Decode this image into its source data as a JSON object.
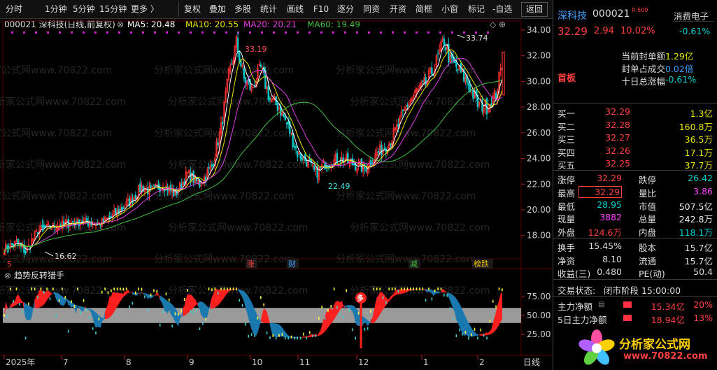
{
  "toolbar": {
    "periods": [
      "分时",
      "1分钟",
      "5分钟",
      "15分钟",
      "更多 〉"
    ],
    "buttons": [
      "复权",
      "叠加",
      "多股",
      "统计",
      "画线",
      "F10",
      "逐分",
      "同资",
      "开资",
      "简框",
      "小窗",
      "标记",
      "-自选"
    ],
    "back": "返回"
  },
  "chart": {
    "title": "000021 深科技(日线,前复权)",
    "ma5": "MA5: 20.48",
    "ma10": "MA10: 20.55",
    "ma20": "MA20: 20.21",
    "ma60": "MA60: 19.49",
    "yticks": [
      "34.00",
      "32.00",
      "30.00",
      "28.00",
      "26.00",
      "24.00",
      "22.00",
      "20.00",
      "18.00"
    ],
    "high1": "33.19",
    "high2": "33.74",
    "low1": "22.49",
    "low0": "16.62",
    "events": [
      "涨",
      "财",
      "减",
      "榜跌"
    ],
    "event_colors": [
      "#ff4040",
      "#40a0ff",
      "#40c040",
      "#e8c000"
    ],
    "s_marker": "S",
    "watermark": "分析家公式网www.70822.com",
    "ind_title": "趋势反转猎手",
    "ind_yticks": [
      "75.00",
      "50.00",
      "25.00"
    ],
    "duo": "多",
    "xticks": [
      "2025年",
      "7",
      "8",
      "9",
      "10",
      "11",
      "12",
      "1",
      "2"
    ],
    "xlabel": "日线"
  },
  "colors": {
    "up": "#ff3030",
    "down": "#00c8c8",
    "ma5": "#ffffff",
    "ma10": "#e8e800",
    "ma20": "#e040e0",
    "ma60": "#40c040"
  },
  "quote": {
    "name": "深科技",
    "code": "000021",
    "tag": "R 500",
    "sector": "消费电子",
    "sector_chg": "-0.61%",
    "price": "32.29",
    "chg": "2.94",
    "pct": "10.02%",
    "board": "首板",
    "seal_amt_label": "当前封单额",
    "seal_amt": "1.29亿",
    "seal_ratio_label": "封单占成交",
    "seal_ratio": "0.02倍",
    "ten_day_label": "十日总涨幅",
    "ten_day": "-0.61%",
    "bids": [
      {
        "label": "买一",
        "price": "32.29",
        "vol": "1.3亿"
      },
      {
        "label": "买二",
        "price": "32.28",
        "vol": "160.8万"
      },
      {
        "label": "买三",
        "price": "32.27",
        "vol": "36.5万"
      },
      {
        "label": "买四",
        "price": "32.26",
        "vol": "17.1万"
      },
      {
        "label": "买五",
        "price": "32.25",
        "vol": "37.7万"
      }
    ],
    "stats": [
      [
        {
          "l": "涨停",
          "v": "32.29",
          "c": "red"
        },
        {
          "l": "跌停",
          "v": "26.42",
          "c": "grn"
        }
      ],
      [
        {
          "l": "最高",
          "v": "32.29",
          "c": "red"
        },
        {
          "l": "量比",
          "v": "3.86",
          "c": "mag"
        }
      ],
      [
        {
          "l": "最低",
          "v": "28.95",
          "c": "grn"
        },
        {
          "l": "市值",
          "v": "507.5亿",
          "c": "wht"
        }
      ],
      [
        {
          "l": "现量",
          "v": "3882",
          "c": "mag"
        },
        {
          "l": "总量",
          "v": "242.8万",
          "c": "wht"
        }
      ],
      [
        {
          "l": "外盘",
          "v": "124.6万",
          "c": "red"
        },
        {
          "l": "内盘",
          "v": "118.1万",
          "c": "grn"
        }
      ]
    ],
    "stats2": [
      [
        {
          "l": "换手",
          "v": "15.45%"
        },
        {
          "l": "股本",
          "v": "15.7亿"
        }
      ],
      [
        {
          "l": "净资",
          "v": "8.10"
        },
        {
          "l": "流通",
          "v": "15.7亿"
        }
      ],
      [
        {
          "l": "收益(三)",
          "v": "0.480"
        },
        {
          "l": "PE(动)",
          "v": "50.4"
        }
      ]
    ],
    "status_label": "交易状态:",
    "status": "闭市阶段 15:00:00",
    "main_flow_label": "主力净额",
    "main_flow": "15.34亿",
    "main_flow_pct": "20%",
    "flow5_label": "5日主力净额",
    "flow5": "18.94亿",
    "flow5_pct": "13%",
    "logo_text": "分析家公式网",
    "logo_url": "www.70822.com"
  }
}
